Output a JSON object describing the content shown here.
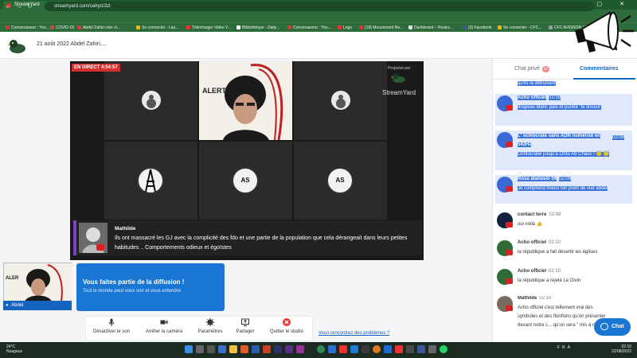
{
  "browser": {
    "tab_title": "StreamYard",
    "new_tab": "+",
    "window_controls": "— ▢ ✕",
    "url": "streamyard.com/oahyrz3zt",
    "bookmarks": [
      {
        "label": "Conversaseur : You...",
        "color": "#d33"
      },
      {
        "label": "COVID-19",
        "color": "#c44"
      },
      {
        "label": "Abdel Zahiri crée vi...",
        "color": "#e33"
      },
      {
        "label": "Se connecter - Lau...",
        "color": "#f4b400"
      },
      {
        "label": "Télécharger Vidéo Y...",
        "color": "#e33"
      },
      {
        "label": "Bibliothèque - Daily...",
        "color": "#fff"
      },
      {
        "label": "Conversaseur : You...",
        "color": "#d33"
      },
      {
        "label": "Logo",
        "color": "#e33"
      },
      {
        "label": "(18) Mouvement Re...",
        "color": "#d33"
      },
      {
        "label": "Dashboard – Restre...",
        "color": "#ddd"
      },
      {
        "label": "(3) Facebook",
        "color": "#3b5998"
      },
      {
        "label": "Se connecter - CFC...",
        "color": "#f4b400"
      },
      {
        "label": "CFC AVIGNON | Plu...",
        "color": "#999"
      }
    ]
  },
  "header": {
    "title": "21 août 2022 Abdel Zahiri,..."
  },
  "stage": {
    "live_badge": "EN DIRECT 4:54:57",
    "powered_by": "Propulsé par",
    "brand": "StreamYard",
    "badge_text": "AS",
    "banner_name": "Mathilde",
    "banner_text": "Ils ont massacré les GJ avec la complicité des fdo et une partie de la population que cela dérangeait dans leurs petites habitudes .. Comportements odieux et égoïstes"
  },
  "self_preview": {
    "name": "Abdel"
  },
  "info_card": {
    "title": "Vous faites partie de la diffusion !",
    "body": "Tout le monde peut vous voir et vous entendre"
  },
  "toolbar": {
    "mute": "Désactiver le son",
    "camera": "Arrêter la caméra",
    "settings": "Paramètres",
    "share": "Partager",
    "leave": "Quitter le studio",
    "problem": "Vous rencontrez des problèmes ?"
  },
  "sidebar": {
    "tab_private": "Chat privé",
    "tab_private_count": "12",
    "tab_comments": "Commentaires",
    "messages": [
      {
        "name": "",
        "time": "",
        "text": "qu'ils la détruisent"
      },
      {
        "name": "Acho officiel",
        "time": "02:09",
        "text": "drapeau blanc paix et pureté \"le linceul\""
      },
      {
        "name": "L' ochlocrate sans ADN numérisé en 543Hz",
        "time": "02:09",
        "text": "Ochlocratie jusqu'à Ordo Ab Chaos ! 😇 😇"
      },
      {
        "name": "Rosa atanasio 59",
        "time": "02:09",
        "text": "Je comprend mieux ton point de vue abdel"
      },
      {
        "name": "contact terre",
        "time": "02:09",
        "text": "oui voilà 👍"
      },
      {
        "name": "Acho officiel",
        "time": "02:10",
        "text": "la république a fait déserté les églises"
      },
      {
        "name": "Acho officiel",
        "time": "02:10",
        "text": "la république a rejeté Le Divin"
      },
      {
        "name": "Mathilde",
        "time": "02:10",
        "text": "Acho officiel c'est tellement vrai des symboles et des flonflons qu'on présenter devant notre c... qu'on sera \" mis à nue \""
      }
    ],
    "chat_button": "Chat"
  },
  "taskbar": {
    "temp": "24°C",
    "weather": "Nuageux",
    "lang": "FRA",
    "time": "02:10",
    "date": "22/08/2022"
  }
}
